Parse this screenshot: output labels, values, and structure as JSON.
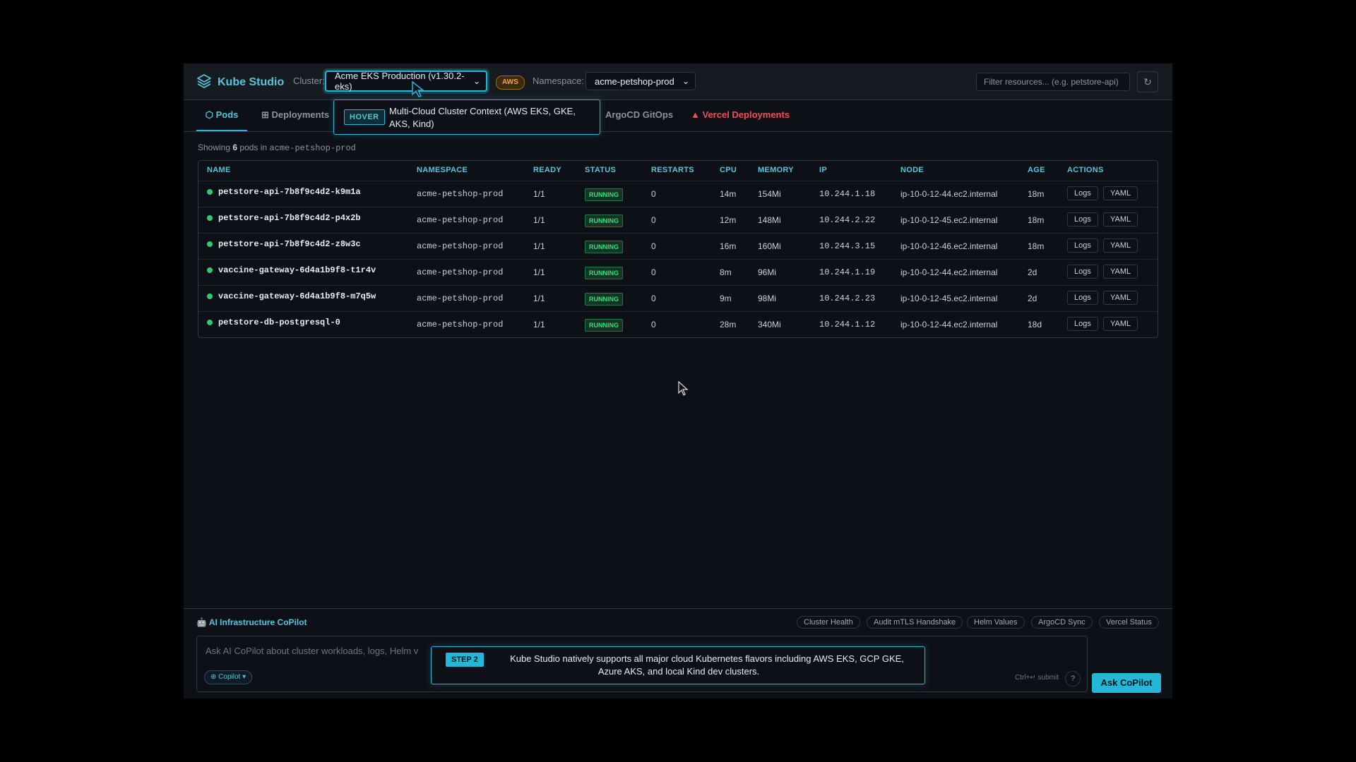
{
  "app": {
    "name": "Kube Studio",
    "cluster_label": "Cluster:",
    "cluster_value": "Acme EKS Production (v1.30.2-eks)",
    "provider_badge": "AWS",
    "namespace_label": "Namespace:",
    "namespace_value": "acme-petshop-prod",
    "filter_placeholder": "Filter resources... (e.g. petstore-api)",
    "refresh_icon": "refresh-icon"
  },
  "tabs": {
    "pods": "Pods",
    "deployments": "Deployments",
    "argocd": "ArgoCD GitOps",
    "vercel": "Vercel Deployments"
  },
  "popover": {
    "badge": "HOVER",
    "text": "Multi-Cloud Cluster Context (AWS EKS, GKE, AKS, Kind)"
  },
  "summary": {
    "prefix": "Showing",
    "count": "6",
    "middle": "pods in",
    "namespace": "acme-petshop-prod"
  },
  "table": {
    "headers": [
      "NAME",
      "NAMESPACE",
      "READY",
      "STATUS",
      "RESTARTS",
      "CPU",
      "MEMORY",
      "IP",
      "NODE",
      "AGE",
      "ACTIONS"
    ],
    "rows": [
      {
        "name": "petstore-api-7b8f9c4d2-k9m1a",
        "namespace": "acme-petshop-prod",
        "ready": "1/1",
        "status": "RUNNING",
        "restarts": "0",
        "cpu": "14m",
        "memory": "154Mi",
        "ip": "10.244.1.18",
        "node": "ip-10-0-12-44.ec2.internal",
        "age": "18m"
      },
      {
        "name": "petstore-api-7b8f9c4d2-p4x2b",
        "namespace": "acme-petshop-prod",
        "ready": "1/1",
        "status": "RUNNING",
        "restarts": "0",
        "cpu": "12m",
        "memory": "148Mi",
        "ip": "10.244.2.22",
        "node": "ip-10-0-12-45.ec2.internal",
        "age": "18m"
      },
      {
        "name": "petstore-api-7b8f9c4d2-z8w3c",
        "namespace": "acme-petshop-prod",
        "ready": "1/1",
        "status": "RUNNING",
        "restarts": "0",
        "cpu": "16m",
        "memory": "160Mi",
        "ip": "10.244.3.15",
        "node": "ip-10-0-12-46.ec2.internal",
        "age": "18m"
      },
      {
        "name": "vaccine-gateway-6d4a1b9f8-t1r4v",
        "namespace": "acme-petshop-prod",
        "ready": "1/1",
        "status": "RUNNING",
        "restarts": "0",
        "cpu": "8m",
        "memory": "96Mi",
        "ip": "10.244.1.19",
        "node": "ip-10-0-12-44.ec2.internal",
        "age": "2d"
      },
      {
        "name": "vaccine-gateway-6d4a1b9f8-m7q5w",
        "namespace": "acme-petshop-prod",
        "ready": "1/1",
        "status": "RUNNING",
        "restarts": "0",
        "cpu": "9m",
        "memory": "98Mi",
        "ip": "10.244.2.23",
        "node": "ip-10-0-12-45.ec2.internal",
        "age": "2d"
      },
      {
        "name": "petstore-db-postgresql-0",
        "namespace": "acme-petshop-prod",
        "ready": "1/1",
        "status": "RUNNING",
        "restarts": "0",
        "cpu": "28m",
        "memory": "340Mi",
        "ip": "10.244.1.12",
        "node": "ip-10-0-12-44.ec2.internal",
        "age": "18d"
      }
    ],
    "logs_label": "Logs",
    "yaml_label": "YAML"
  },
  "copilot": {
    "title": "AI Infrastructure CoPilot",
    "chips": [
      "Cluster Health",
      "Audit mTLS Handshake",
      "Helm Values",
      "ArgoCD Sync",
      "Vercel Status"
    ],
    "placeholder": "Ask AI CoPilot about cluster workloads, logs, Helm v",
    "mode_chip": "⊕ Copilot ▾",
    "submit_hint": "Ctrl+↵ submit",
    "help": "?",
    "ask_button": "Ask CoPilot"
  },
  "step": {
    "badge": "STEP 2",
    "text": "Kube Studio natively supports all major cloud Kubernetes flavors including AWS EKS, GCP GKE, Azure AKS, and local Kind dev clusters."
  },
  "colors": {
    "accent": "#22b8d6",
    "running": "#3fdc7a",
    "vercel": "#f0505a",
    "aws": "#f0a840"
  }
}
